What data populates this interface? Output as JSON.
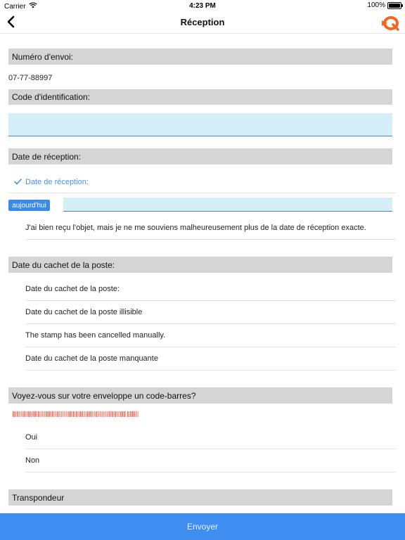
{
  "status_bar": {
    "carrier": "Carrier",
    "time": "4:23 PM",
    "battery": "100%",
    "battery_level": 1.0
  },
  "nav": {
    "title": "Réception",
    "back_icon": "chevron-left-icon",
    "logo_icon": "brand-logo-icon"
  },
  "shipment": {
    "header": "Numéro d'envoi:",
    "value": "07-77-88997"
  },
  "identification": {
    "header": "Code d'identification:",
    "value": ""
  },
  "reception_date": {
    "header": "Date de réception:",
    "checked_option": "Date de réception:",
    "today_button": "aujourd'hui",
    "date_value": "",
    "forgot_option": "J'ai bien reçu l'objet, mais je ne me souviens malheureusement plus de la date de réception exacte."
  },
  "postmark": {
    "header": "Date du cachet de la poste:",
    "options": [
      "Date du cachet de la poste:",
      "Date du cachet de la poste illisible",
      "The stamp has been cancelled manually.",
      "Date du cachet de la poste manquante"
    ]
  },
  "barcode_question": {
    "header": "Voyez-vous sur votre enveloppe un code-barres?",
    "options": [
      "Oui",
      "Non"
    ]
  },
  "transponder": {
    "header": "Transpondeur"
  },
  "submit": {
    "label": "Envoyer"
  },
  "colors": {
    "accent": "#3d8ef0",
    "input_bg": "#d5eef7",
    "header_bg": "#d5d5d5",
    "check": "#4a8fe6",
    "logo": "#f26522"
  }
}
